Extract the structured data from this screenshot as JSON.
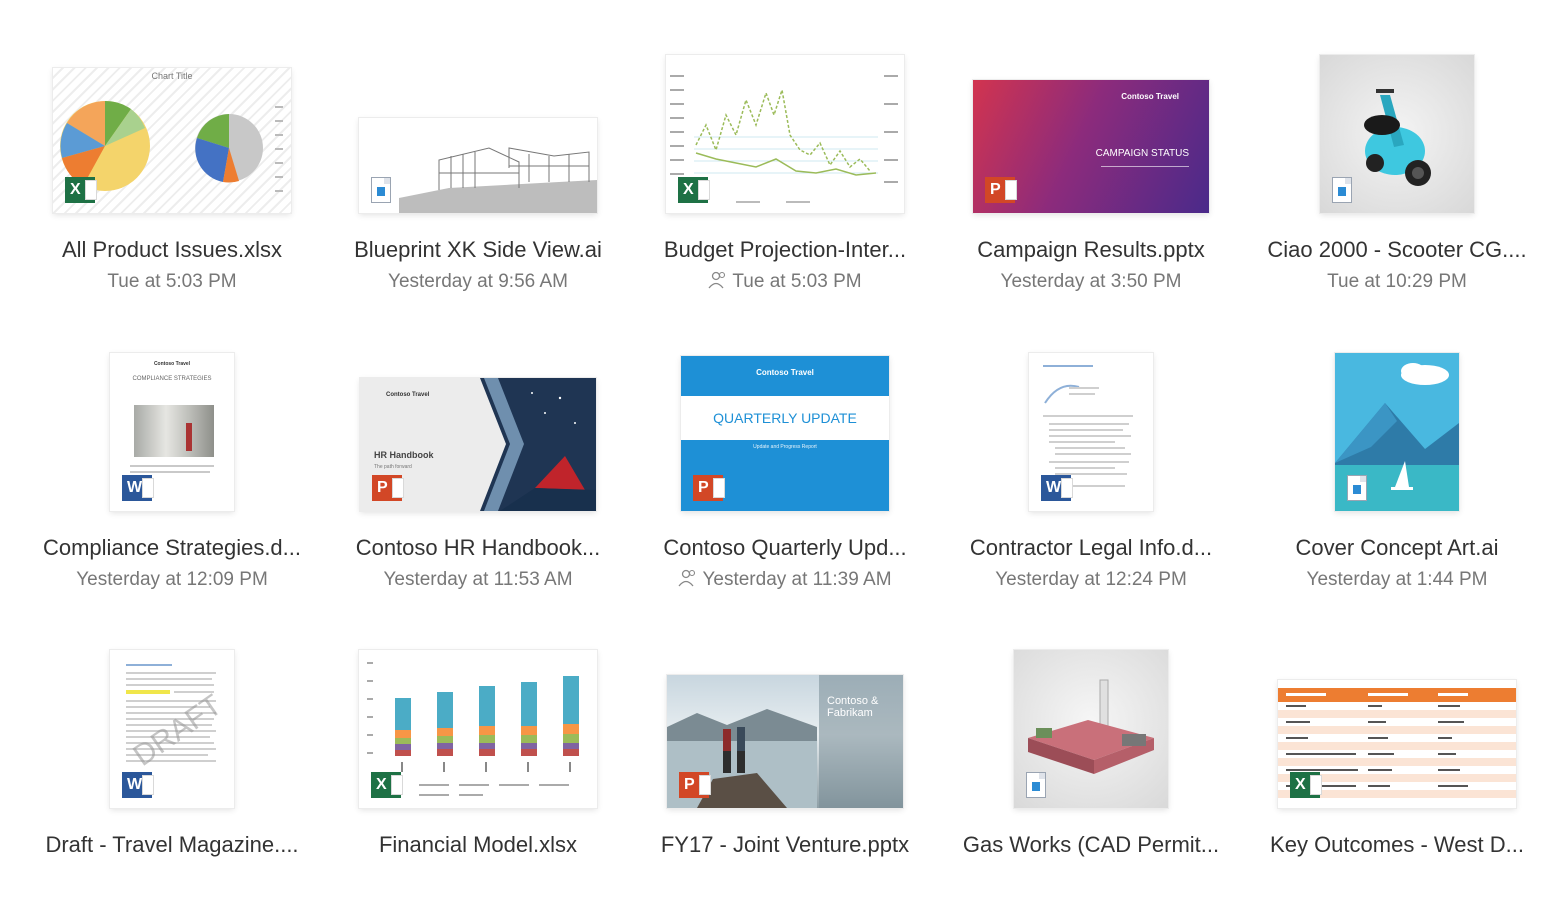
{
  "files": [
    {
      "name": "All Product Issues.xlsx",
      "meta": "Tue at 5:03 PM",
      "app": "excel",
      "shared": false
    },
    {
      "name": "Blueprint XK Side View.ai",
      "meta": "Yesterday at 9:56 AM",
      "app": "generic",
      "shared": false
    },
    {
      "name": "Budget Projection-Inter...",
      "meta": "Tue at 5:03 PM",
      "app": "excel",
      "shared": true
    },
    {
      "name": "Campaign Results.pptx",
      "meta": "Yesterday at 3:50 PM",
      "app": "powerpoint",
      "shared": false
    },
    {
      "name": "Ciao 2000 - Scooter CG....",
      "meta": "Tue at 10:29 PM",
      "app": "generic",
      "shared": false
    },
    {
      "name": "Compliance Strategies.d...",
      "meta": "Yesterday at 12:09 PM",
      "app": "word",
      "shared": false
    },
    {
      "name": "Contoso HR Handbook...",
      "meta": "Yesterday at 11:53 AM",
      "app": "powerpoint",
      "shared": false
    },
    {
      "name": "Contoso Quarterly Upd...",
      "meta": "Yesterday at 11:39 AM",
      "app": "powerpoint",
      "shared": true
    },
    {
      "name": "Contractor Legal Info.d...",
      "meta": "Yesterday at 12:24 PM",
      "app": "word",
      "shared": false
    },
    {
      "name": "Cover Concept Art.ai",
      "meta": "Yesterday at 1:44 PM",
      "app": "generic",
      "shared": false
    },
    {
      "name": "Draft - Travel Magazine....",
      "meta": "",
      "app": "word",
      "shared": false
    },
    {
      "name": "Financial Model.xlsx",
      "meta": "",
      "app": "excel",
      "shared": false
    },
    {
      "name": "FY17 - Joint Venture.pptx",
      "meta": "",
      "app": "powerpoint",
      "shared": false
    },
    {
      "name": "Gas Works (CAD Permit...",
      "meta": "",
      "app": "generic",
      "shared": false
    },
    {
      "name": "Key Outcomes - West D...",
      "meta": "",
      "app": "excel",
      "shared": false
    }
  ],
  "thumbs": {
    "pie_title": "Chart Title",
    "campaign_brand": "Contoso Travel",
    "campaign_title": "CAMPAIGN STATUS",
    "compliance_brand": "Contoso Travel",
    "compliance_title": "COMPLIANCE STRATEGIES",
    "hr_brand": "Contoso Travel",
    "hr_title": "HR Handbook",
    "hr_sub": "The path forward",
    "quarterly_brand": "Contoso Travel",
    "quarterly_title": "QUARTERLY UPDATE",
    "quarterly_sub": "Update and Progress Report",
    "draft_watermark": "DRAFT",
    "fy17_brand": "Contoso & Fabrikam"
  },
  "badges": {
    "excel": "X",
    "powerpoint": "P",
    "word": "W"
  },
  "colors": {
    "excel": "#1e7145",
    "powerpoint": "#d24726",
    "word": "#2b579a",
    "accent": "#1e90d6"
  }
}
